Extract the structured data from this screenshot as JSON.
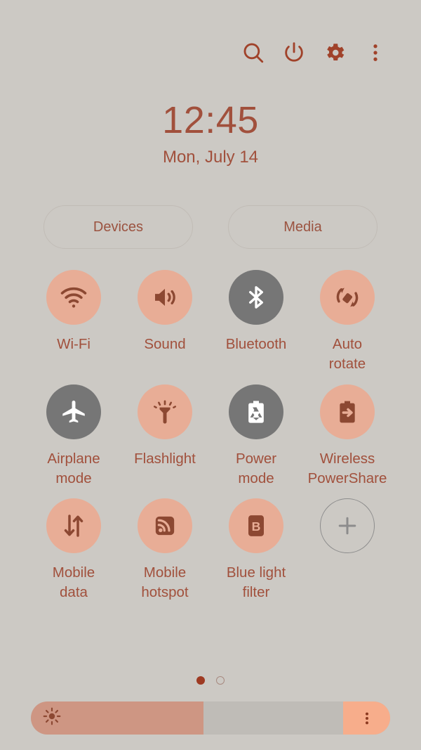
{
  "theme": {
    "background": "#ccc9c4",
    "accent_text": "#a1503c",
    "active_circle": "#e8ad96",
    "inactive_circle": "#767676",
    "icon_on_color": "#8c4832",
    "icon_off_color": "#ffffff",
    "top_icon_color": "#a0422a",
    "brightness_fill": "#ce9683",
    "brightness_track": "#bfbcb7",
    "brightness_right": "#f7ad8b",
    "dot_active": "#9e3a22"
  },
  "topbar": {
    "search_label": "Search",
    "search_icon": "search-icon",
    "power_label": "Power off",
    "power_icon": "power-icon",
    "settings_label": "Settings",
    "settings_icon": "gear-icon",
    "more_label": "More options",
    "more_icon": "more-vertical-icon"
  },
  "status": {
    "time": "12:45",
    "date": "Mon, July 14"
  },
  "pills": [
    {
      "label": "Devices",
      "name": "devices-pill"
    },
    {
      "label": "Media",
      "name": "media-pill"
    }
  ],
  "tiles": [
    {
      "label": "Wi-Fi",
      "icon": "wifi-icon",
      "state": "on"
    },
    {
      "label": "Sound",
      "icon": "sound-icon",
      "state": "on"
    },
    {
      "label": "Bluetooth",
      "icon": "bluetooth-icon",
      "state": "off"
    },
    {
      "label": "Auto\nrotate",
      "icon": "auto-rotate-icon",
      "state": "on"
    },
    {
      "label": "Airplane\nmode",
      "icon": "airplane-icon",
      "state": "off"
    },
    {
      "label": "Flashlight",
      "icon": "flashlight-icon",
      "state": "on"
    },
    {
      "label": "Power\nmode",
      "icon": "power-mode-icon",
      "state": "off"
    },
    {
      "label": "Wireless\nPowerShare",
      "icon": "wireless-powershare-icon",
      "state": "on"
    },
    {
      "label": "Mobile\ndata",
      "icon": "mobile-data-icon",
      "state": "on"
    },
    {
      "label": "Mobile\nhotspot",
      "icon": "mobile-hotspot-icon",
      "state": "on"
    },
    {
      "label": "Blue light\nfilter",
      "icon": "blue-light-filter-icon",
      "state": "on"
    },
    {
      "label": "",
      "icon": "plus-icon",
      "state": "add"
    }
  ],
  "pager": {
    "page_count": 2,
    "current_page": 1
  },
  "brightness": {
    "value_percent": 48,
    "right_segment_percent": 13,
    "sun_icon": "brightness-sun-icon",
    "menu_icon": "more-vertical-icon"
  }
}
